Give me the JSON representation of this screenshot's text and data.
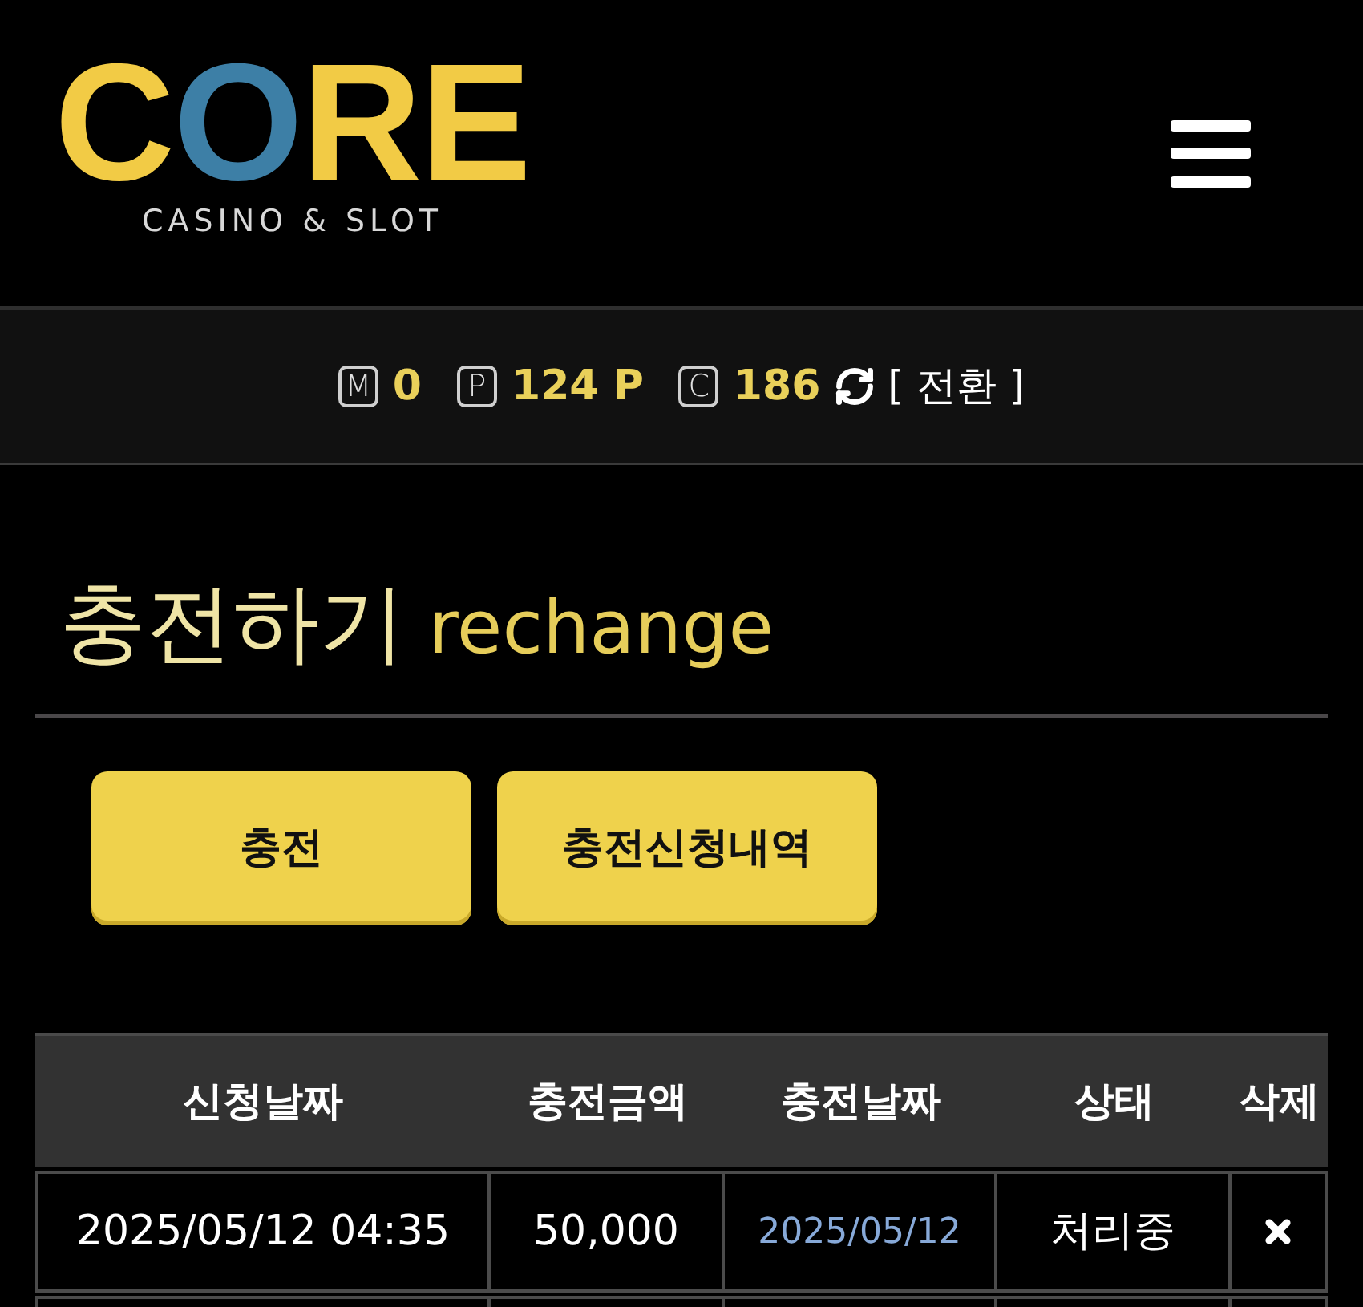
{
  "header": {
    "logo": {
      "parts": [
        {
          "text": "C",
          "color": "#f2cb45"
        },
        {
          "text": "O",
          "color": "#3d7fa6"
        },
        {
          "text": "RE",
          "color": "#f2cb45"
        }
      ],
      "tagline": "CASINO & SLOT"
    }
  },
  "balance_bar": {
    "items": [
      {
        "badge": "M",
        "value": "0"
      },
      {
        "badge": "P",
        "value": "124 P"
      },
      {
        "badge": "C",
        "value": "186"
      }
    ],
    "convert_link": "[ 전환 ]"
  },
  "page_title": {
    "korean": "충전하기",
    "english": "rechange"
  },
  "buttons": [
    {
      "label": "충전"
    },
    {
      "label": "충전신청내역"
    }
  ],
  "table": {
    "columns": [
      "신청날짜",
      "충전금액",
      "충전날짜",
      "상태",
      "삭제"
    ],
    "rows": [
      {
        "request_date": "2025/05/12 04:35",
        "amount": "50,000",
        "charge_date": "2025/05/12",
        "status": "처리중"
      }
    ]
  }
}
